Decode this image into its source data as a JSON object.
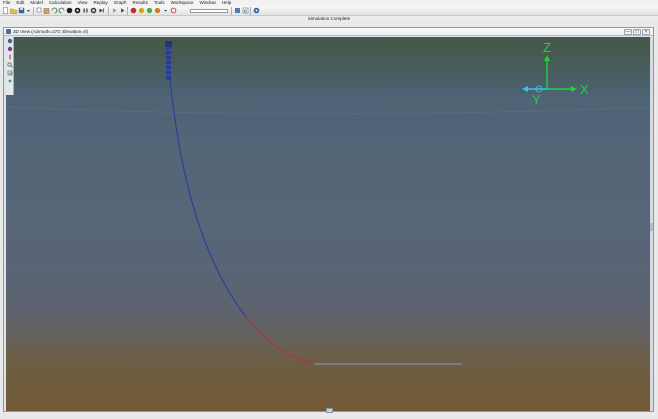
{
  "menubar": {
    "items": [
      "File",
      "Edit",
      "Model",
      "Calculation",
      "View",
      "Replay",
      "Graph",
      "Results",
      "Tools",
      "Workspace",
      "Window",
      "Help"
    ]
  },
  "toolbar": {
    "buttons": [
      "new-icon",
      "open-icon",
      "save-icon",
      "print-icon",
      "copy-icon",
      "paste-icon",
      "undo-icon",
      "redo-icon",
      "statics-icon",
      "run-icon",
      "pause-icon",
      "stop-icon",
      "step-icon",
      "start-replay-icon",
      "slider-icon",
      "view-icon",
      "graph-icon",
      "help-icon"
    ]
  },
  "status": {
    "text": "Simulation Complete"
  },
  "view_window": {
    "title": "3D View (Azimuth=270; Elevation=0)",
    "controls": {
      "minimize": "—",
      "maximize": "□",
      "close": "×"
    }
  },
  "scene": {
    "axes": {
      "z_label": "Z",
      "x_label": "X",
      "y_label": "Y"
    },
    "colors": {
      "axis_green": "#1fd33a",
      "axis_cyan": "#32c8e6",
      "riser_blue": "#2a3c9a",
      "riser_red": "#b0324a",
      "seabed_line": "#8a97b8"
    }
  }
}
